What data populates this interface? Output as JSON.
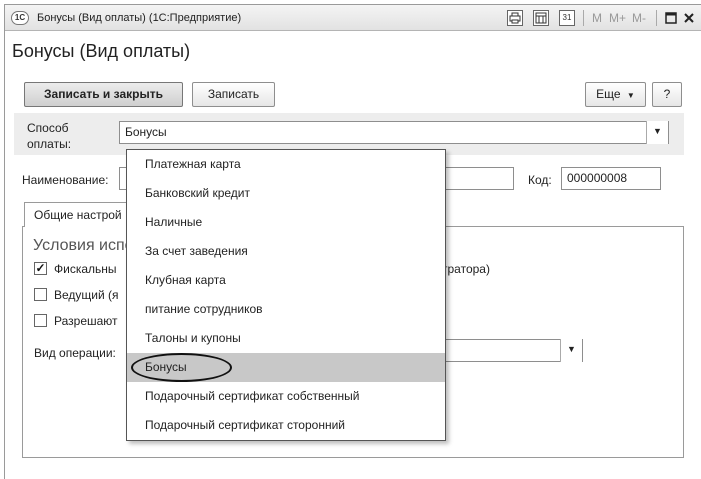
{
  "window": {
    "title": "Бонусы (Вид оплаты)  (1С:Предприятие)",
    "logo": "1С",
    "toolbar_icons": [
      "printer-icon",
      "calculator-icon",
      "calendar-icon"
    ],
    "calendar_day": "31",
    "memory_buttons": [
      "M",
      "M+",
      "M-"
    ],
    "window_buttons": [
      "maximize-icon",
      "close-icon"
    ]
  },
  "page": {
    "title": "Бонусы (Вид оплаты)"
  },
  "toolbar": {
    "save_close_label": "Записать и закрыть",
    "save_label": "Записать",
    "more_label": "Еще",
    "help_label": "?"
  },
  "form": {
    "payment_method_label_line1": "Способ",
    "payment_method_label_line2": "оплаты:",
    "payment_method_value": "Бонусы",
    "name_label": "Наименование:",
    "name_value": "",
    "code_label": "Код:",
    "code_value": "000000008"
  },
  "tabs": {
    "general_label": "Общие настрой"
  },
  "conditions": {
    "title": "Условия испо",
    "fiscal_label": "Фискальны",
    "fiscal_checked": true,
    "fiscal_suffix": "стратора)",
    "leading_label": "Ведущий (я",
    "leading_checked": false,
    "allowed_label": "Разрешают",
    "allowed_checked": false,
    "operation_label": "Вид операции:"
  },
  "dropdown": {
    "items": [
      "Платежная карта",
      "Банковский кредит",
      "Наличные",
      "За счет заведения",
      "Клубная карта",
      "питание сотрудников",
      "Талоны и купоны",
      "Бонусы",
      "Подарочный сертификат собственный",
      "Подарочный сертификат сторонний"
    ],
    "selected": "Бонусы"
  }
}
